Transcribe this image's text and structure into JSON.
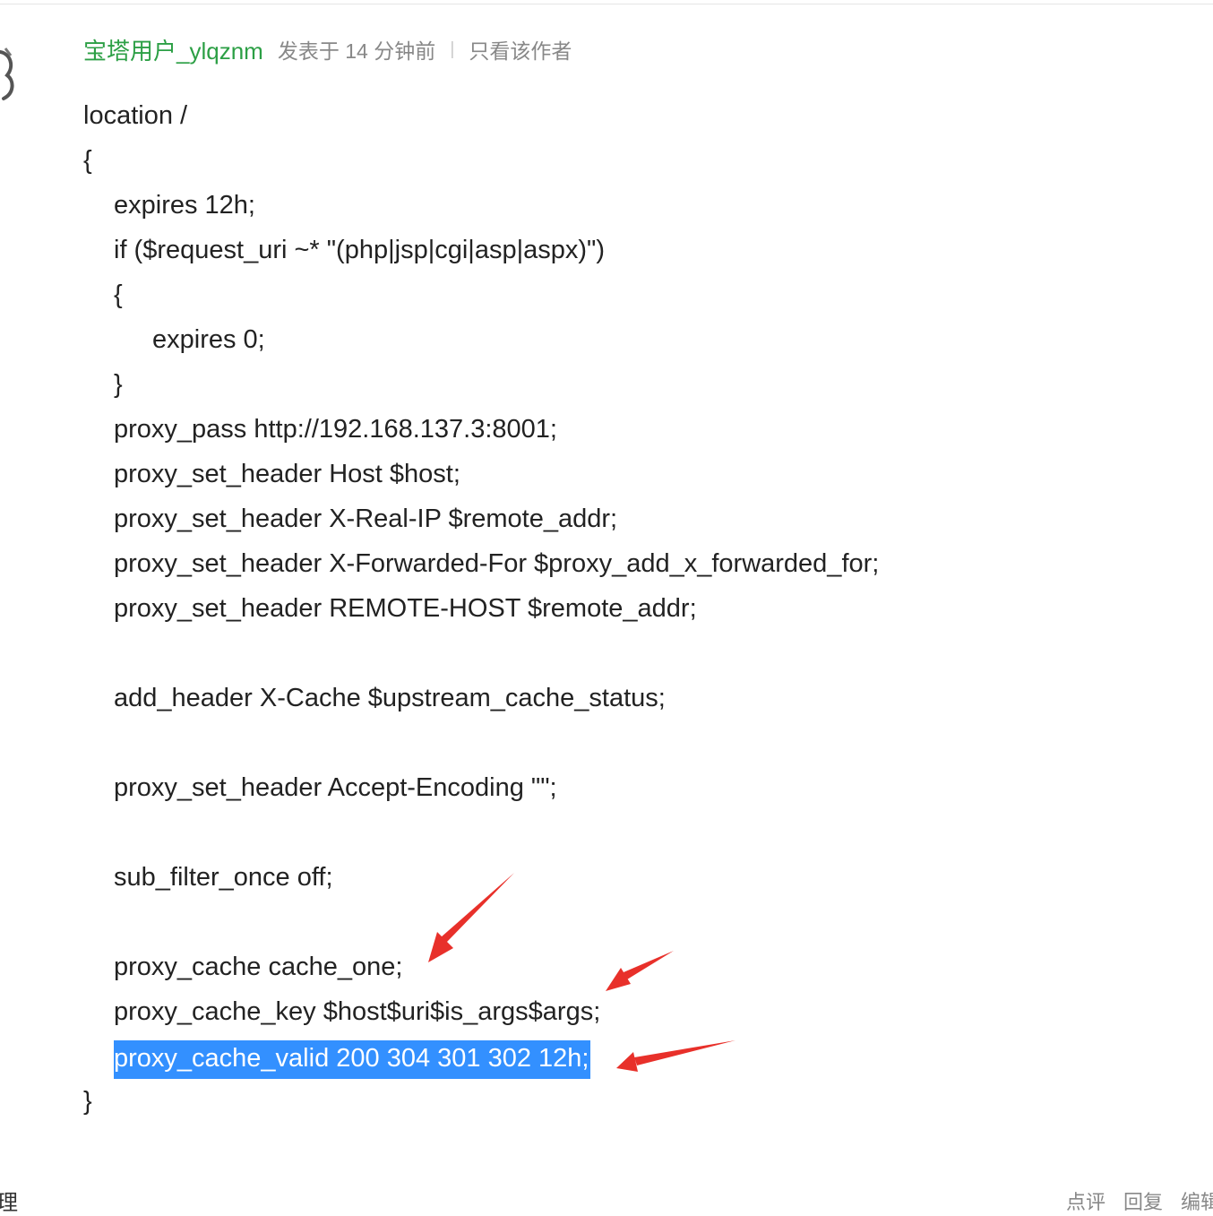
{
  "post": {
    "author": "宝塔用户_ylqznm",
    "posted_time": "发表于 14 分钟前",
    "separator": "|",
    "only_author_label": "只看该作者"
  },
  "code_lines": [
    "location /",
    "{",
    "expires 12h;",
    "if ($request_uri ~* \"(php|jsp|cgi|asp|aspx)\")",
    "{",
    "expires 0;",
    "}",
    "proxy_pass http://192.168.137.3:8001;",
    "proxy_set_header Host $host;",
    "proxy_set_header X-Real-IP $remote_addr;",
    "proxy_set_header X-Forwarded-For $proxy_add_x_forwarded_for;",
    "proxy_set_header REMOTE-HOST $remote_addr;",
    "add_header X-Cache $upstream_cache_status;",
    "proxy_set_header Accept-Encoding \"\";",
    "sub_filter_once off;",
    "proxy_cache cache_one;",
    "proxy_cache_key $host$uri$is_args$args;",
    "proxy_cache_valid 200 304 301 302 12h;",
    "}"
  ],
  "selected_line_index": 17,
  "annotation_color": "#e8302a",
  "selection_color": "#3390ff",
  "author_color": "#2c9f45",
  "footer": {
    "left_fragment": "理",
    "actions": [
      "点评",
      "回复",
      "编辑"
    ]
  }
}
